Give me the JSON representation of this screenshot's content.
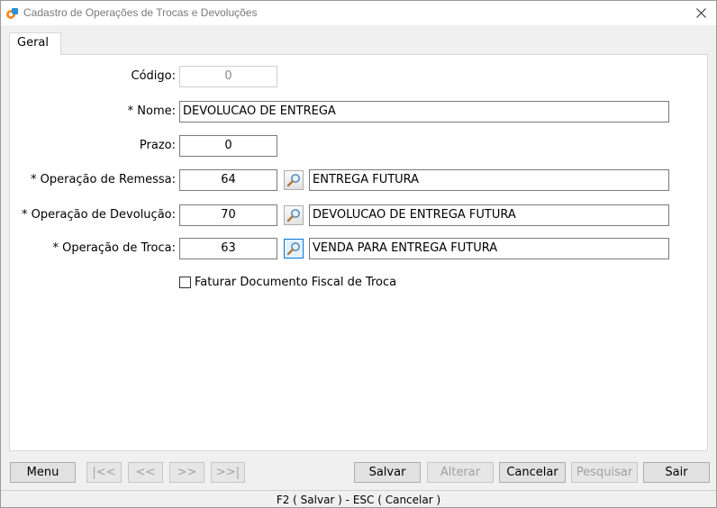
{
  "window": {
    "title": "Cadastro de Operações de Trocas e Devoluções",
    "close": "✕"
  },
  "tabs": [
    {
      "label": "Geral"
    }
  ],
  "form": {
    "codigo": {
      "label": "Código:",
      "value": "0"
    },
    "nome": {
      "label": "* Nome:",
      "value": "DEVOLUCAO DE ENTREGA"
    },
    "prazo": {
      "label": "Prazo:",
      "value": "0"
    },
    "remessa": {
      "label": "* Operação de Remessa:",
      "code": "64",
      "description": "ENTREGA FUTURA"
    },
    "devolucao": {
      "label": "* Operação de Devolução:",
      "code": "70",
      "description": "DEVOLUCAO DE ENTREGA FUTURA"
    },
    "troca": {
      "label": "* Operação de Troca:",
      "code": "63",
      "description": "VENDA PARA ENTREGA FUTURA"
    },
    "faturar": {
      "label": "Faturar Documento Fiscal de Troca",
      "checked": false
    }
  },
  "buttons": {
    "menu": "Menu",
    "first": "|<<",
    "prev": "<<",
    "next": ">>",
    "last": ">>|",
    "salvar": "Salvar",
    "alterar": "Alterar",
    "cancelar": "Cancelar",
    "pesquisar": "Pesquisar",
    "sair": "Sair"
  },
  "status": "F2 ( Salvar )  -  ESC ( Cancelar )",
  "colors": {
    "accent": "#0078d7",
    "app_icon_orange": "#f28c28",
    "app_icon_blue": "#2a8fd6"
  }
}
